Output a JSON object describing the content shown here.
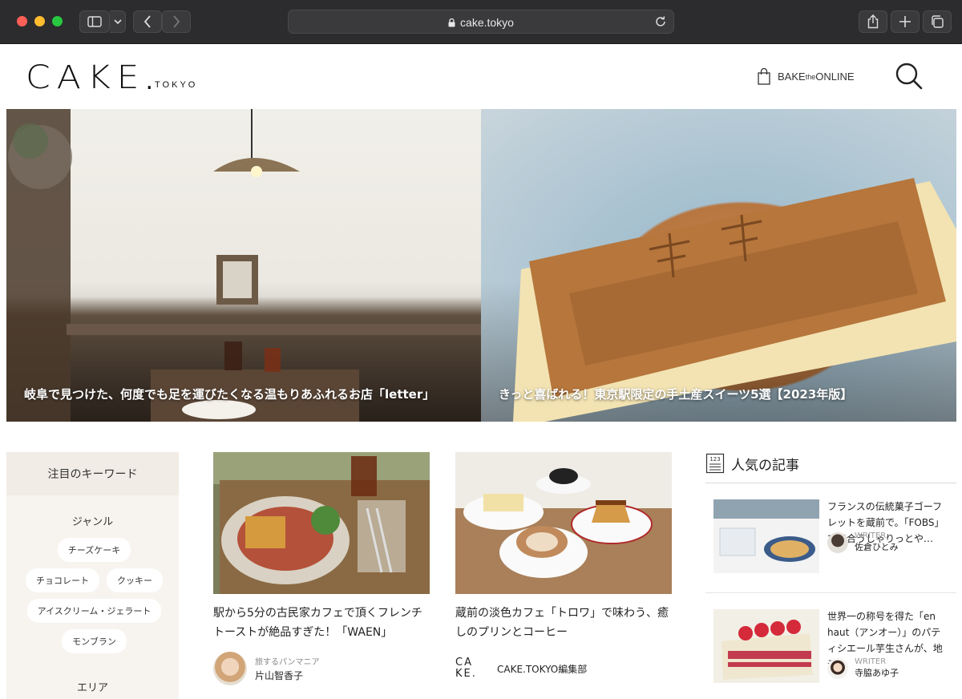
{
  "browser": {
    "url": "cake.tokyo"
  },
  "header": {
    "logo_main": "CAKE",
    "logo_sub": "TOKYO",
    "bake_pre": "BAKE",
    "bake_the": "the",
    "bake_post": "ONLINE"
  },
  "hero": [
    {
      "caption": "岐阜で見つけた、何度でも足を運びたくなる温もりあふれるお店「letter」"
    },
    {
      "caption": "きっと喜ばれる！東京駅限定の手土産スイーツ5選【2023年版】"
    }
  ],
  "keywords": {
    "title": "注目のキーワード",
    "genre_label": "ジャンル",
    "genre": [
      "チーズケーキ",
      "チョコレート",
      "クッキー",
      "アイスクリーム・ジェラート",
      "モンブラン"
    ],
    "area_label": "エリア"
  },
  "articles": [
    {
      "title": "駅から5分の古民家カフェで頂くフレンチトーストが絶品すぎた！「WAEN」",
      "author_role": "旅するパンマニア",
      "author_name": "片山智香子"
    },
    {
      "title": "蔵前の淡色カフェ「トロワ」で味わう、癒しのプリンとコーヒー",
      "author_logo_top": "CA",
      "author_logo_bottom": "KE.",
      "author_name": "CAKE.TOKYO編集部"
    }
  ],
  "popular": {
    "title": "人気の記事",
    "icon_text": "123",
    "items": [
      {
        "text": "フランスの伝統菓子ゴーフレットを蔵前で。「FOBS」で出合うしゃりっとや…",
        "writer_role": "WRITER",
        "writer_name": "佐倉ひとみ"
      },
      {
        "text": "世界一の称号を得た「en haut（アンオー）」のパティシエール芋生さんが、地元…",
        "writer_role": "WRITER",
        "writer_name": "寺脇あゆ子"
      }
    ]
  },
  "colors": {
    "keyword_panel": "#f7f4ef",
    "chrome": "#2c2c2e"
  }
}
